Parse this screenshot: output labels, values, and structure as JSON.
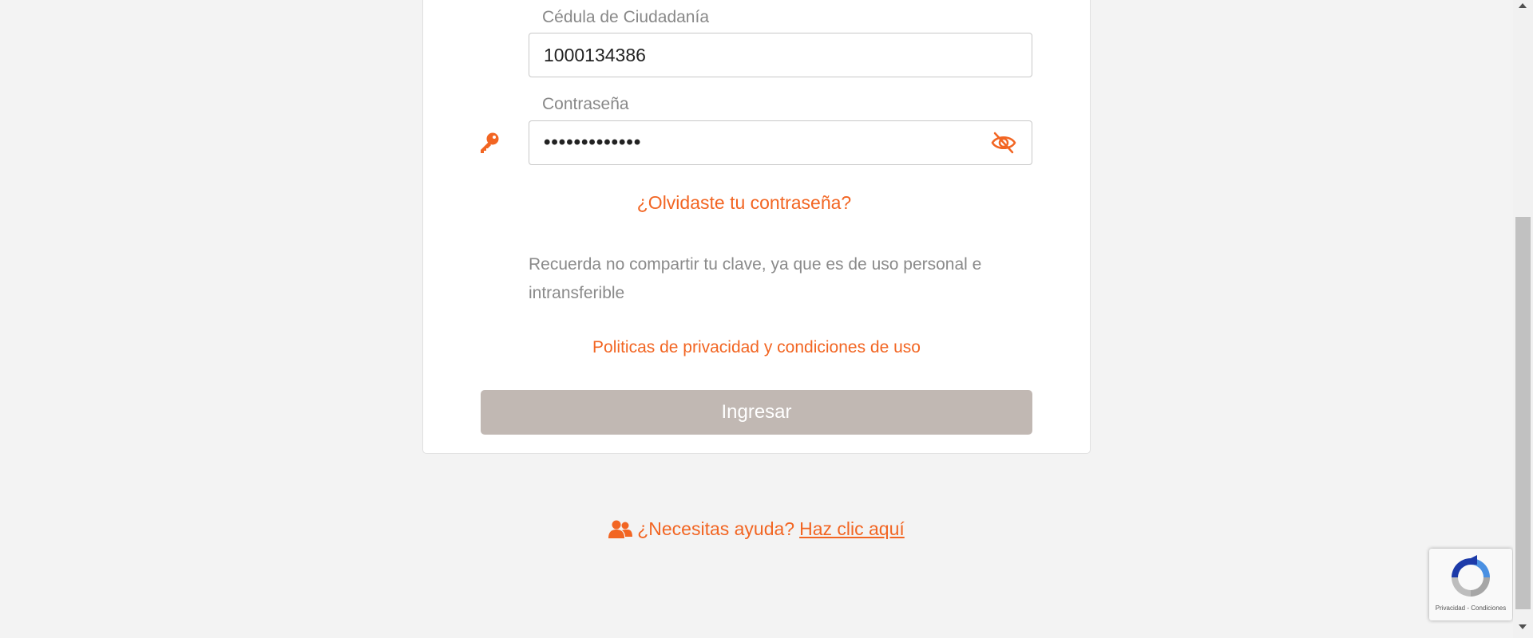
{
  "form": {
    "id_label": "Cédula de Ciudadanía",
    "id_value": "1000134386",
    "password_label": "Contraseña",
    "password_value": "•••••••••••••",
    "forgot_password_link": "¿Olvidaste tu contraseña?",
    "notice": "Recuerda no compartir tu clave, ya que es de uso personal e intransferible",
    "privacy_link": "Politicas de privacidad y condiciones de uso",
    "submit_label": "Ingresar"
  },
  "help": {
    "prompt": "¿Necesitas ayuda?",
    "link": "Haz clic aquí"
  },
  "recaptcha": {
    "terms": "Privacidad - Condiciones"
  },
  "icons": {
    "key": "key-icon",
    "eye": "eye-slash-icon",
    "users": "users-icon",
    "recaptcha": "recaptcha-logo-icon"
  },
  "colors": {
    "accent": "#f26522",
    "button_disabled": "#c1b8b3",
    "background": "#f3f3f3",
    "label_gray": "#888888"
  }
}
